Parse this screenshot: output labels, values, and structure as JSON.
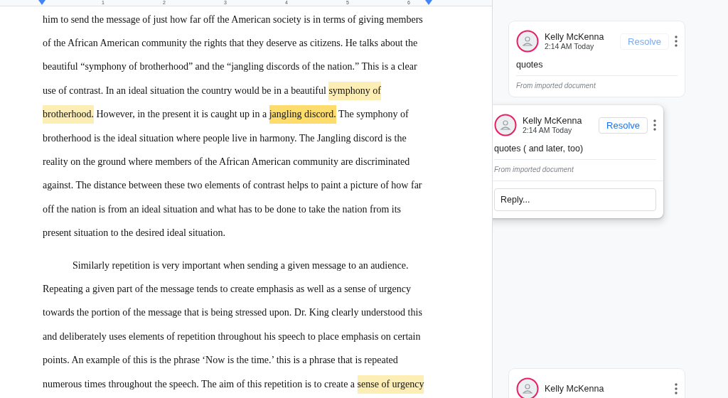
{
  "ruler": {
    "labels": [
      "1",
      "2",
      "3",
      "4",
      "5",
      "6"
    ]
  },
  "document": {
    "paragraphs": [
      {
        "indent": false,
        "lines": [
          [
            {
              "text": "him to send the message of just how far off the American society is in terms of giving members",
              "highlighted": false,
              "current": false
            }
          ],
          [
            {
              "text": "of the African American community the rights that they deserve as citizens. He talks about the",
              "highlighted": false,
              "current": false
            }
          ],
          [
            {
              "text": "beautiful “symphony of brotherhood” and the “jangling discords of the nation.” This is a clear",
              "highlighted": false,
              "current": false
            }
          ],
          [
            {
              "text": "use of contrast. In an ideal situation the country would be in a beautiful ",
              "highlighted": false,
              "current": false
            },
            {
              "text": "symphony of",
              "highlighted": true,
              "current": false
            }
          ],
          [
            {
              "text": "brotherhood.",
              "highlighted": true,
              "current": false
            },
            {
              "text": " However, in the present it is caught up in a ",
              "highlighted": false,
              "current": false
            },
            {
              "text": "jangling discord.",
              "highlighted": true,
              "current": true
            },
            {
              "text": " The symphony of",
              "highlighted": false,
              "current": false
            }
          ],
          [
            {
              "text": "brotherhood is the ideal situation where people live in harmony. The Jangling discord is the",
              "highlighted": false,
              "current": false
            }
          ],
          [
            {
              "text": "reality on the ground where members of the African American community are discriminated",
              "highlighted": false,
              "current": false
            }
          ],
          [
            {
              "text": "against. The distance between these two elements of contrast helps to paint a picture of how far",
              "highlighted": false,
              "current": false
            }
          ],
          [
            {
              "text": "off the nation is from an ideal situation and what has to be done to take the nation from its",
              "highlighted": false,
              "current": false
            }
          ],
          [
            {
              "text": "present situation to the desired ideal situation.",
              "highlighted": false,
              "current": false
            }
          ]
        ]
      },
      {
        "indent": true,
        "lines": [
          [
            {
              "text": "Similarly repetition is very important when sending a given message to an audience.",
              "highlighted": false,
              "current": false
            }
          ],
          [
            {
              "text": "Repeating a given part of the message tends to create emphasis as well as a sense of urgency",
              "highlighted": false,
              "current": false
            }
          ],
          [
            {
              "text": "towards the portion of the message that is being stressed upon. Dr. King clearly understood this",
              "highlighted": false,
              "current": false
            }
          ],
          [
            {
              "text": "and deliberately uses elements of repetition throughout his speech to place emphasis on certain",
              "highlighted": false,
              "current": false
            }
          ],
          [
            {
              "text": "points. An example of this is the phrase ‘Now is the time.’ this is a phrase that is repeated",
              "highlighted": false,
              "current": false
            }
          ],
          [
            {
              "text": "numerous times throughout the speech. The aim of this repetition is to create a ",
              "highlighted": false,
              "current": false
            },
            {
              "text": "sense of urgency",
              "highlighted": true,
              "current": false
            }
          ]
        ]
      }
    ]
  },
  "comments": [
    {
      "active": false,
      "author": "Kelly McKenna",
      "time": "2:14 AM Today",
      "resolve": "Resolve",
      "text": "quotes",
      "note": "From imported document"
    },
    {
      "active": true,
      "author": "Kelly McKenna",
      "time": "2:14 AM Today",
      "resolve": "Resolve",
      "text": "quotes ( and later, too)",
      "note": "From imported document",
      "reply": {
        "placeholder": "Reply..."
      }
    },
    {
      "active": false,
      "author": "Kelly McKenna"
    }
  ]
}
